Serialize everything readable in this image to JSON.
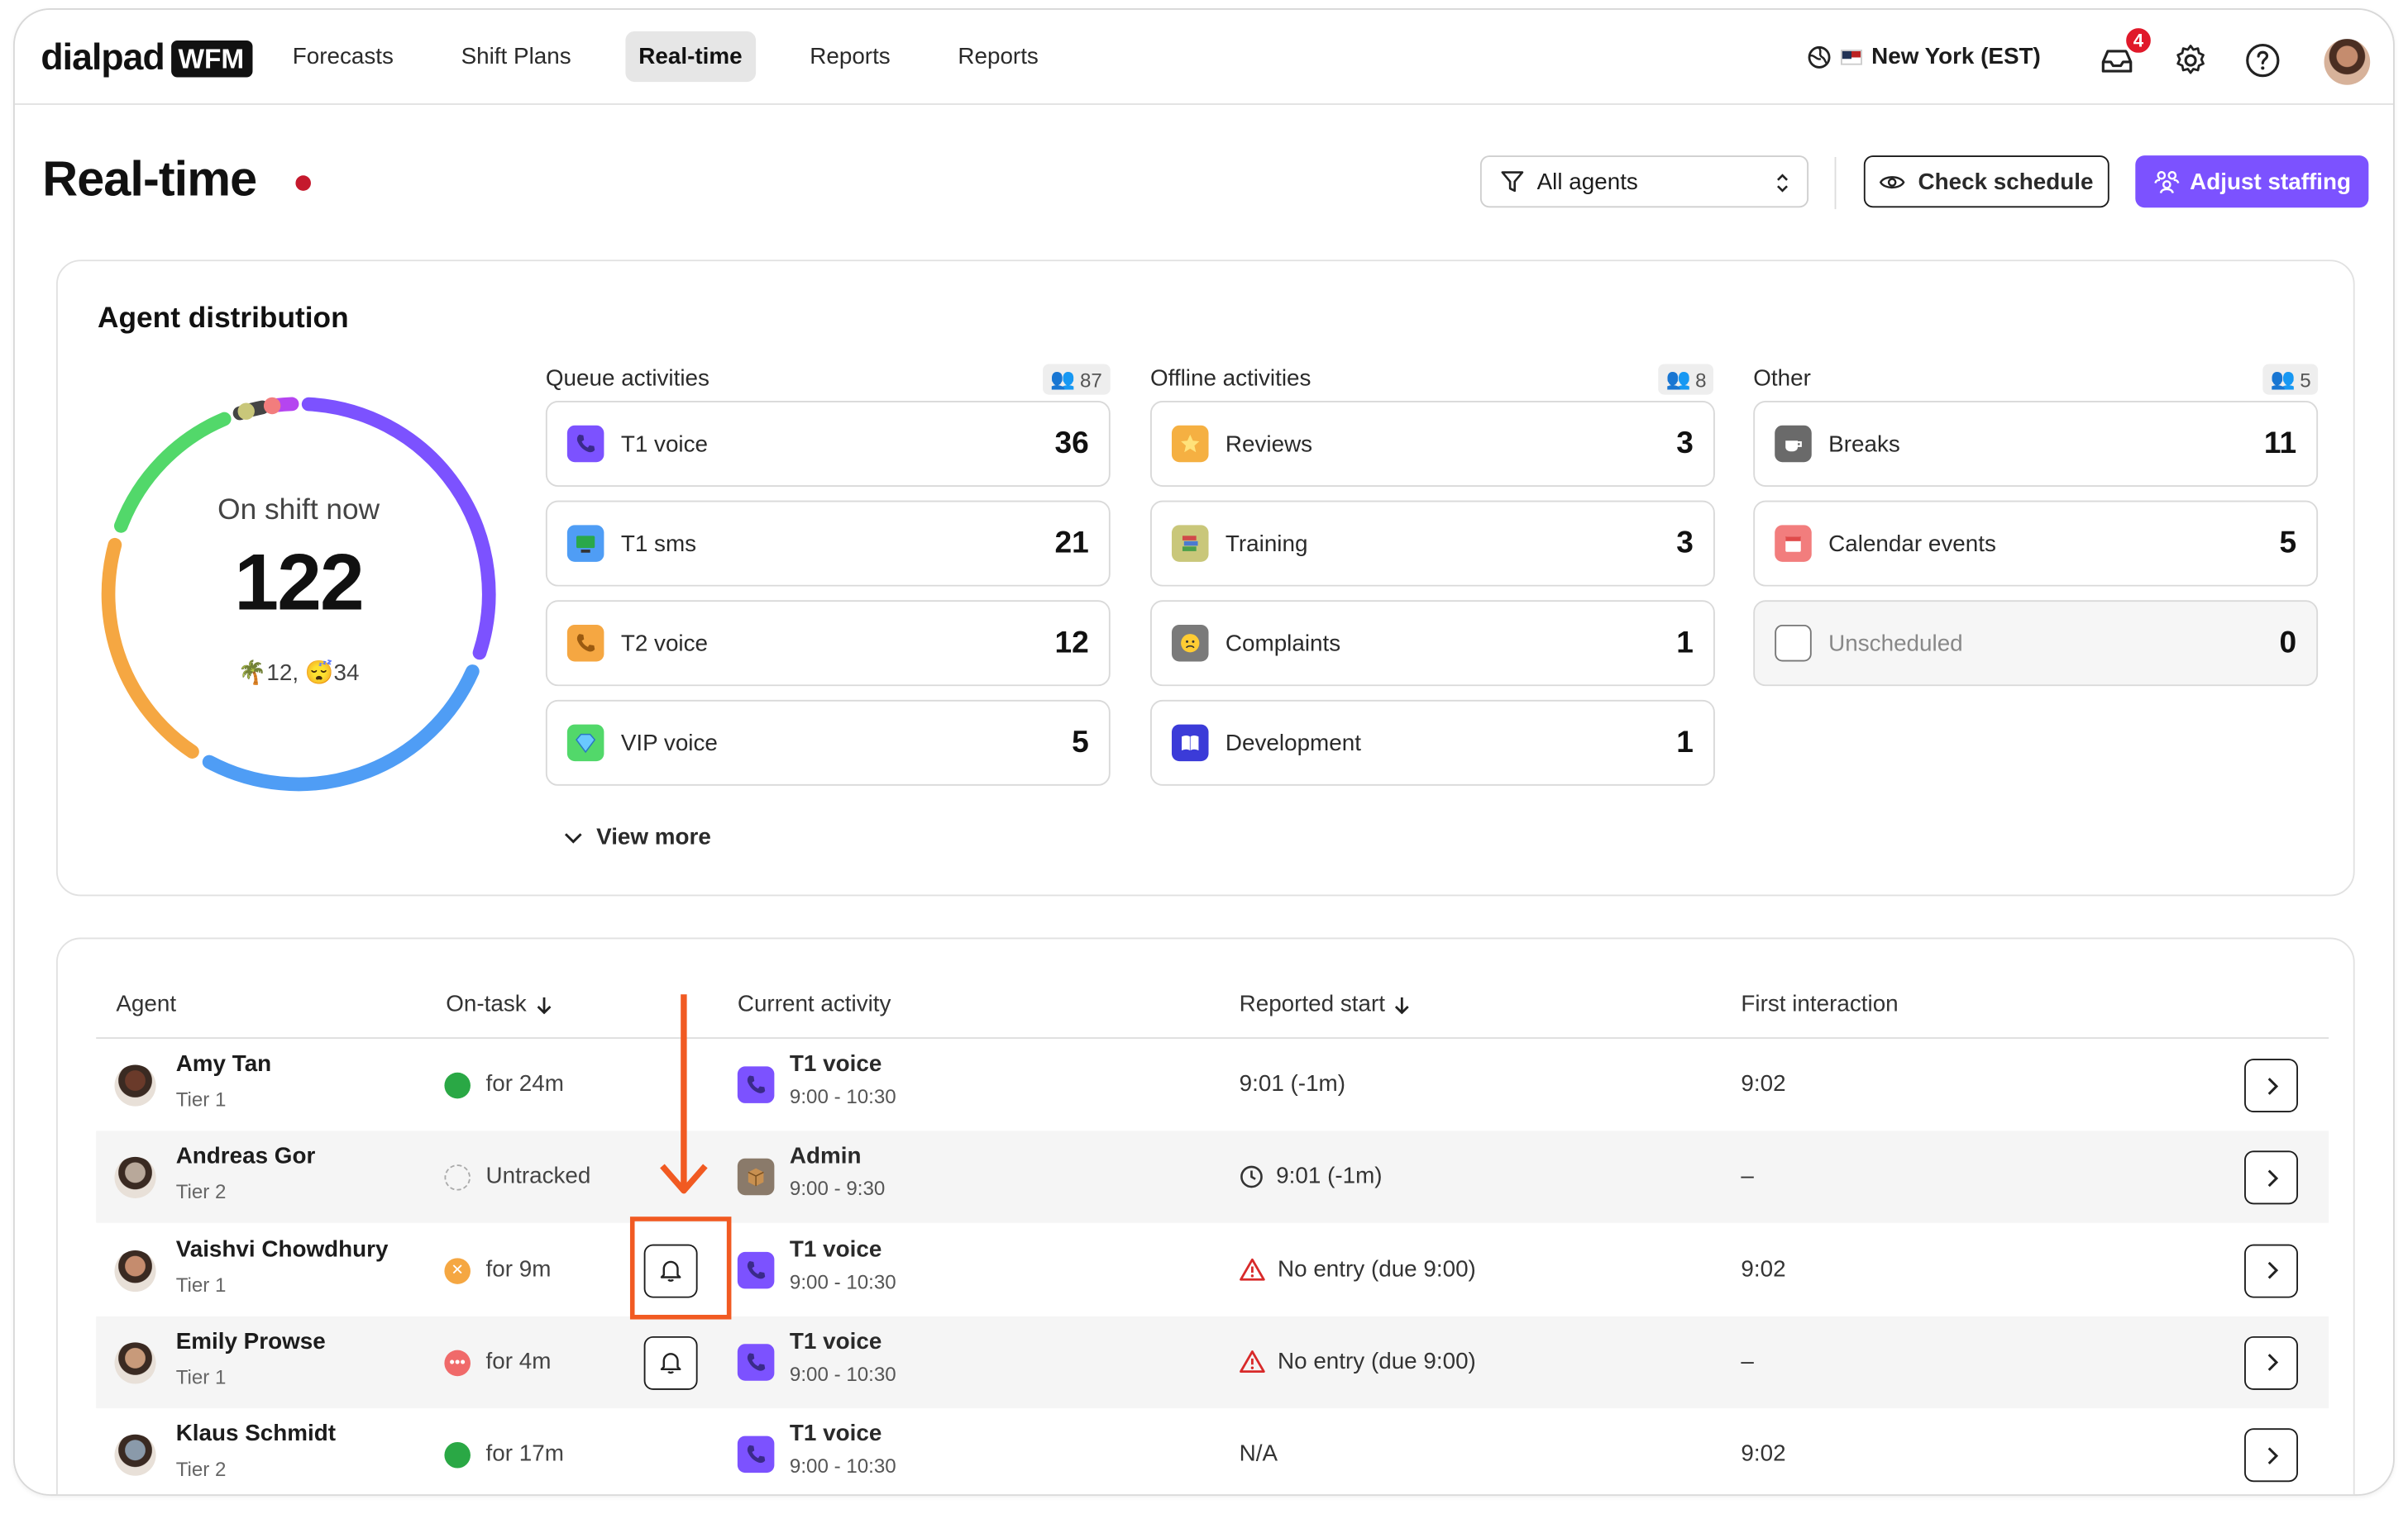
{
  "brand": {
    "name": "dialpad",
    "product": "WFM"
  },
  "nav": [
    {
      "label": "Forecasts",
      "active": false
    },
    {
      "label": "Shift Plans",
      "active": false
    },
    {
      "label": "Real-time",
      "active": true
    },
    {
      "label": "Reports",
      "active": false
    },
    {
      "label": "Reports",
      "active": false
    }
  ],
  "timezone": {
    "label": "New York (EST)",
    "icons": [
      "globe-icon",
      "us-flag-icon"
    ]
  },
  "notifications": {
    "count": "4"
  },
  "page": {
    "title": "Real-time",
    "live_color": "#c5192d"
  },
  "filter": {
    "label": "All agents"
  },
  "buttons": {
    "check_schedule": "Check schedule",
    "adjust_staffing": "Adjust staffing"
  },
  "distribution": {
    "title": "Agent distribution",
    "center_label": "On shift now",
    "center_value": "122",
    "sub": [
      {
        "icon": "palm-tree-icon",
        "value": "12,"
      },
      {
        "icon": "sleep-face-icon",
        "value": "34"
      }
    ],
    "ring_colors": [
      "#7c52ff",
      "#4f9df5",
      "#f5a742",
      "#52d86a",
      "#444444",
      "#b545f0",
      "#c9c77a",
      "#f27d7d"
    ],
    "view_more": "View more",
    "groups": [
      {
        "title": "Queue activities",
        "count": "87",
        "items": [
          {
            "name": "T1 voice",
            "count": "36",
            "icon": "phone-icon",
            "color": "#7c52ff"
          },
          {
            "name": "T1 sms",
            "count": "21",
            "icon": "monitor-icon",
            "color": "#4f9df5"
          },
          {
            "name": "T2 voice",
            "count": "12",
            "icon": "phone-icon",
            "color": "#f5a742"
          },
          {
            "name": "VIP voice",
            "count": "5",
            "icon": "diamond-icon",
            "color": "#52d86a"
          }
        ]
      },
      {
        "title": "Offline activities",
        "count": "8",
        "items": [
          {
            "name": "Reviews",
            "count": "3",
            "icon": "star-icon",
            "color": "#f5b042"
          },
          {
            "name": "Training",
            "count": "3",
            "icon": "books-icon",
            "color": "#c9c77a"
          },
          {
            "name": "Complaints",
            "count": "1",
            "icon": "sad-face-icon",
            "color": "#7a7a7a"
          },
          {
            "name": "Development",
            "count": "1",
            "icon": "book-icon",
            "color": "#3b3bd8"
          }
        ]
      },
      {
        "title": "Other",
        "count": "5",
        "items": [
          {
            "name": "Breaks",
            "count": "11",
            "icon": "coffee-icon",
            "color": "#6a6a6a"
          },
          {
            "name": "Calendar events",
            "count": "5",
            "icon": "calendar-icon",
            "color": "#f27d7d"
          },
          {
            "name": "Unscheduled",
            "count": "0",
            "icon": "empty-square-icon",
            "color": "#ffffff"
          }
        ]
      }
    ]
  },
  "table": {
    "headers": {
      "agent": "Agent",
      "on_task": "On-task",
      "current_activity": "Current activity",
      "reported_start": "Reported start",
      "first_interaction": "First interaction"
    },
    "rows": [
      {
        "name": "Amy Tan",
        "tier": "Tier 1",
        "status": "green",
        "status_text": "for 24m",
        "bell": false,
        "activity": "T1 voice",
        "activity_time": "9:00 - 10:30",
        "activity_color": "#7c52ff",
        "reported": "9:01 (-1m)",
        "reported_icon": "",
        "first": "9:02"
      },
      {
        "name": "Andreas Gor",
        "tier": "Tier 2",
        "status": "untracked",
        "status_text": "Untracked",
        "bell": false,
        "activity": "Admin",
        "activity_time": "9:00 - 9:30",
        "activity_color": "#8a7a6a",
        "reported": "9:01 (-1m)",
        "reported_icon": "clock-icon",
        "first": "–"
      },
      {
        "name": "Vaishvi Chowdhury",
        "tier": "Tier 1",
        "status": "orange",
        "status_text": "for 9m",
        "bell": true,
        "activity": "T1 voice",
        "activity_time": "9:00 - 10:30",
        "activity_color": "#7c52ff",
        "reported": "No entry (due 9:00)",
        "reported_icon": "warning-icon",
        "first": "9:02"
      },
      {
        "name": "Emily Prowse",
        "tier": "Tier 1",
        "status": "red",
        "status_text": "for 4m",
        "bell": true,
        "activity": "T1 voice",
        "activity_time": "9:00 - 10:30",
        "activity_color": "#7c52ff",
        "reported": "No entry (due 9:00)",
        "reported_icon": "warning-icon",
        "first": "–"
      },
      {
        "name": "Klaus Schmidt",
        "tier": "Tier 2",
        "status": "green",
        "status_text": "for 17m",
        "bell": false,
        "activity": "T1 voice",
        "activity_time": "9:00 - 10:30",
        "activity_color": "#7c52ff",
        "reported": "N/A",
        "reported_icon": "",
        "first": "9:02"
      }
    ]
  },
  "annotation": {
    "color": "#f15a22"
  }
}
